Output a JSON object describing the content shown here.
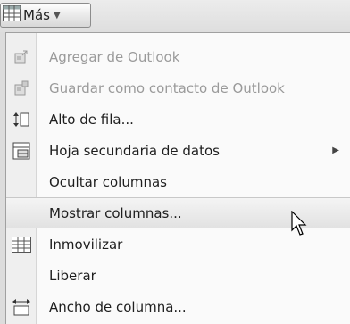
{
  "toolbar": {
    "mas_label": "Más"
  },
  "menu": {
    "items": [
      {
        "label": "Agregar de Outlook",
        "icon": "add-from-outlook-icon",
        "disabled": true,
        "submenu": false
      },
      {
        "label": "Guardar como contacto de Outlook",
        "icon": "save-outlook-contact-icon",
        "disabled": true,
        "submenu": false
      },
      {
        "label": "Alto de fila...",
        "icon": "row-height-icon",
        "disabled": false,
        "submenu": false
      },
      {
        "label": "Hoja secundaria de datos",
        "icon": "subdatasheet-icon",
        "disabled": false,
        "submenu": true
      },
      {
        "label": "Ocultar columnas",
        "icon": "",
        "disabled": false,
        "submenu": false
      },
      {
        "label": "Mostrar columnas...",
        "icon": "",
        "disabled": false,
        "submenu": false,
        "highlighted": true
      },
      {
        "label": "Inmovilizar",
        "icon": "freeze-icon",
        "disabled": false,
        "submenu": false
      },
      {
        "label": "Liberar",
        "icon": "",
        "disabled": false,
        "submenu": false
      },
      {
        "label": "Ancho de columna...",
        "icon": "column-width-icon",
        "disabled": false,
        "submenu": false
      }
    ]
  }
}
